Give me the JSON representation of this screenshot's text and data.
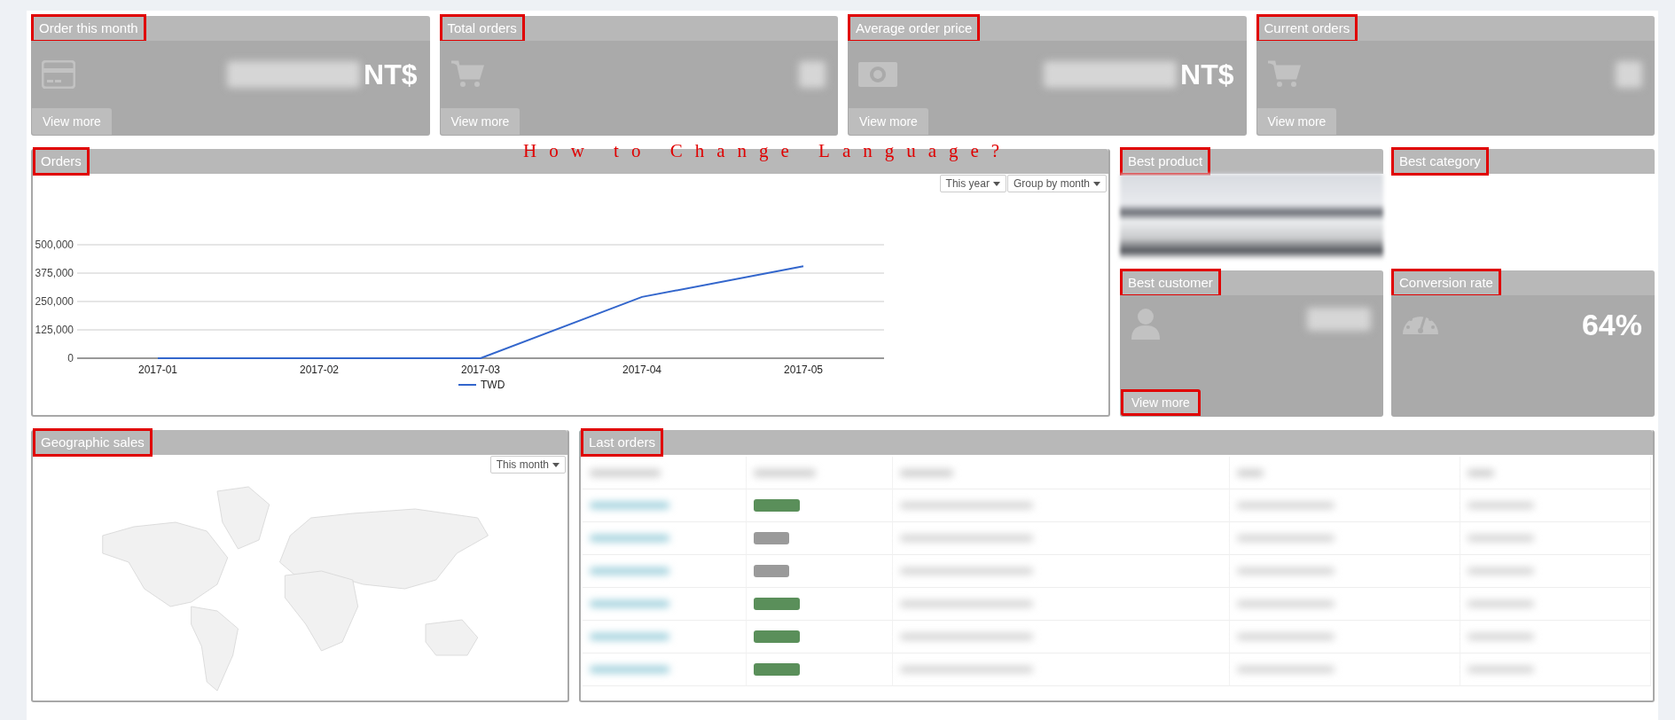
{
  "annotation": {
    "text": "How to Change Language?"
  },
  "stat_cards": [
    {
      "title": "Order this month",
      "annotated": true,
      "kind": "card",
      "unit": "NT$",
      "link": "View more"
    },
    {
      "title": "Total orders",
      "annotated": true,
      "kind": "cart",
      "link": "View more"
    },
    {
      "title": "Average order price",
      "annotated": true,
      "kind": "money",
      "unit": "NT$",
      "link": "View more"
    },
    {
      "title": "Current orders",
      "annotated": true,
      "kind": "cart",
      "link": "View more"
    }
  ],
  "orders": {
    "title": "Orders",
    "annotated": true,
    "controls": [
      "This year",
      "Group by month"
    ],
    "chart_data": {
      "type": "line",
      "grid": true,
      "categories": [
        "2017-01",
        "2017-02",
        "2017-03",
        "2017-04",
        "2017-05"
      ],
      "series": [
        {
          "name": "TWD",
          "color": "#3366cc",
          "values": [
            0,
            0,
            0,
            270000,
            405000
          ]
        }
      ],
      "ylim": [
        0,
        500000
      ],
      "yticks": [
        {
          "value": 0,
          "label": "0"
        },
        {
          "value": 125000,
          "label": "125,000"
        },
        {
          "value": 250000,
          "label": "250,000"
        },
        {
          "value": 375000,
          "label": "375,000"
        },
        {
          "value": 500000,
          "label": "500,000"
        }
      ]
    }
  },
  "side_cards": [
    {
      "title": "Best product",
      "annotated": true,
      "kind": "image"
    },
    {
      "title": "Best category",
      "annotated": true,
      "kind": "empty"
    },
    {
      "title": "Best customer",
      "annotated": true,
      "kind": "user",
      "link": "View more",
      "link_annotated": true
    },
    {
      "title": "Conversion rate",
      "annotated": true,
      "kind": "gauge",
      "value": "64%"
    }
  ],
  "geographic": {
    "title": "Geographic sales",
    "annotated": true,
    "filter": "This month"
  },
  "last_orders": {
    "title": "Last orders",
    "annotated": true,
    "rows": [
      {
        "color": "#5a8f5a"
      },
      {
        "color": "#9a9a9a"
      },
      {
        "color": "#9a9a9a"
      },
      {
        "color": "#5a8f5a"
      },
      {
        "color": "#5a8f5a"
      },
      {
        "color": "#5a8f5a"
      }
    ]
  }
}
